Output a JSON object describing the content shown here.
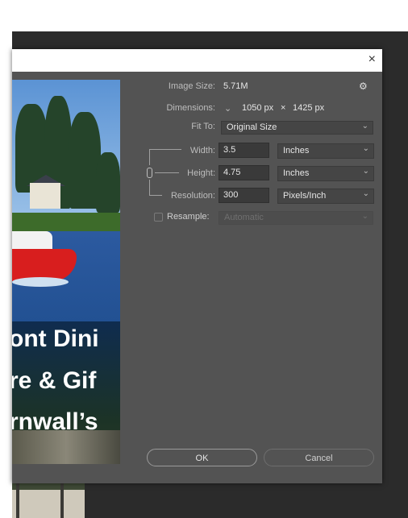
{
  "dialog": {
    "close_icon": "×",
    "gear_icon": "⚙"
  },
  "image_size": {
    "label": "Image Size:",
    "value": "5.71M"
  },
  "dimensions": {
    "label": "Dimensions:",
    "width": "1050 px",
    "times": "×",
    "height": "1425 px"
  },
  "fit_to": {
    "label": "Fit To:",
    "value": "Original Size"
  },
  "width": {
    "label": "Width:",
    "value": "3.5",
    "unit": "Inches"
  },
  "height": {
    "label": "Height:",
    "value": "4.75",
    "unit": "Inches"
  },
  "resolution": {
    "label": "Resolution:",
    "value": "300",
    "unit": "Pixels/Inch"
  },
  "resample": {
    "label": "Resample:",
    "value": "Automatic",
    "checked": false
  },
  "buttons": {
    "ok": "OK",
    "cancel": "Cancel"
  },
  "preview": {
    "line1": "ont Dini",
    "line2": "re & Gif",
    "line3": "rnwall’s"
  },
  "colors": {
    "dialog_bg": "#535353",
    "workspace": "#2b2b2b",
    "boat": "#d81e1e"
  }
}
